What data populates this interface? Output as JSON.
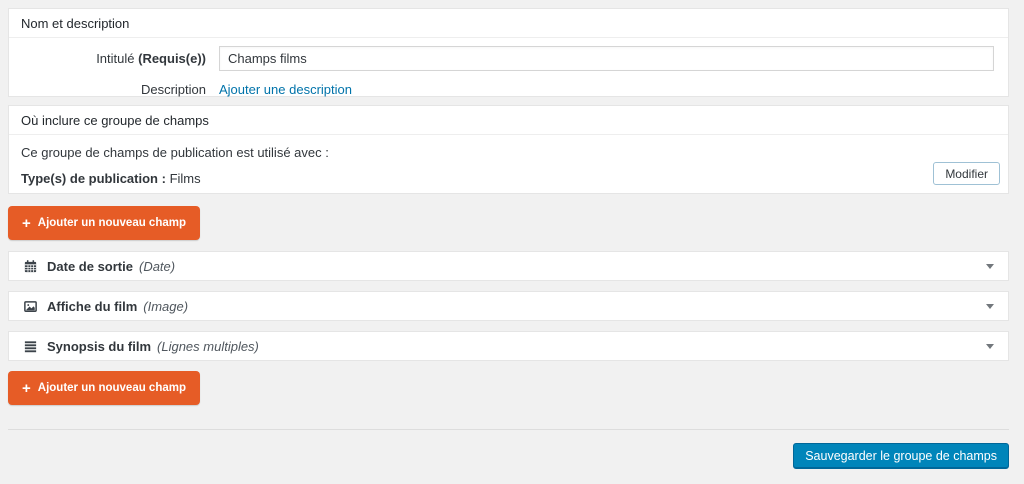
{
  "colors": {
    "page_bg": "#f1f1f1",
    "panel_bg": "#ffffff",
    "accent_orange": "#e65c26",
    "primary_blue": "#0085ba",
    "link_blue": "#0073aa"
  },
  "name_section": {
    "title": "Nom et description",
    "label_prefix": "Intitulé ",
    "label_required": "(Requis(e))",
    "input_value": "Champs films",
    "description_label": "Description",
    "description_link": "Ajouter une description"
  },
  "location_section": {
    "title": "Où inclure ce groupe de champs",
    "usage_text": "Ce groupe de champs de publication est utilisé avec :",
    "post_type_label": "Type(s) de publication :",
    "post_type_value": "Films",
    "edit_button": "Modifier"
  },
  "add_field_button": {
    "plus": "+",
    "label": "Ajouter un nouveau champ"
  },
  "fields": [
    {
      "icon": "calendar-icon",
      "name": "Date de sortie",
      "type": "(Date)"
    },
    {
      "icon": "image-icon",
      "name": "Affiche du film",
      "type": "(Image)"
    },
    {
      "icon": "lines-icon",
      "name": "Synopsis du film",
      "type": "(Lignes multiples)"
    }
  ],
  "footer": {
    "save_button": "Sauvegarder le groupe de champs"
  }
}
